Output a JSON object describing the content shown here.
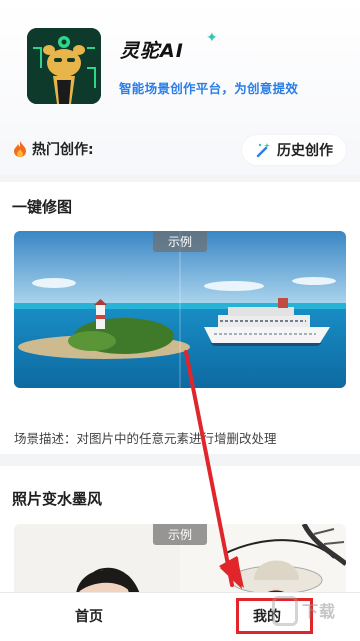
{
  "app": {
    "name": "灵驼AI",
    "slogan": "智能场景创作平台，为创意提效"
  },
  "hot": {
    "title": "热门创作:",
    "history_label": "历史创作"
  },
  "cards": [
    {
      "title": "一键修图",
      "badge": "示例",
      "description": "场景描述：对图片中的任意元素进行增删改处理"
    },
    {
      "title": "照片变水墨风",
      "badge": "示例"
    }
  ],
  "tabbar": {
    "home": "首页",
    "mine": "我的"
  },
  "watermark": "下载",
  "colors": {
    "slogan": "#2a7de8",
    "annotation": "#e0262b",
    "sea": "#1ea1d0"
  },
  "icons": [
    "camel-logo-icon",
    "sparkle-icon",
    "fire-icon",
    "magic-wand-icon"
  ]
}
